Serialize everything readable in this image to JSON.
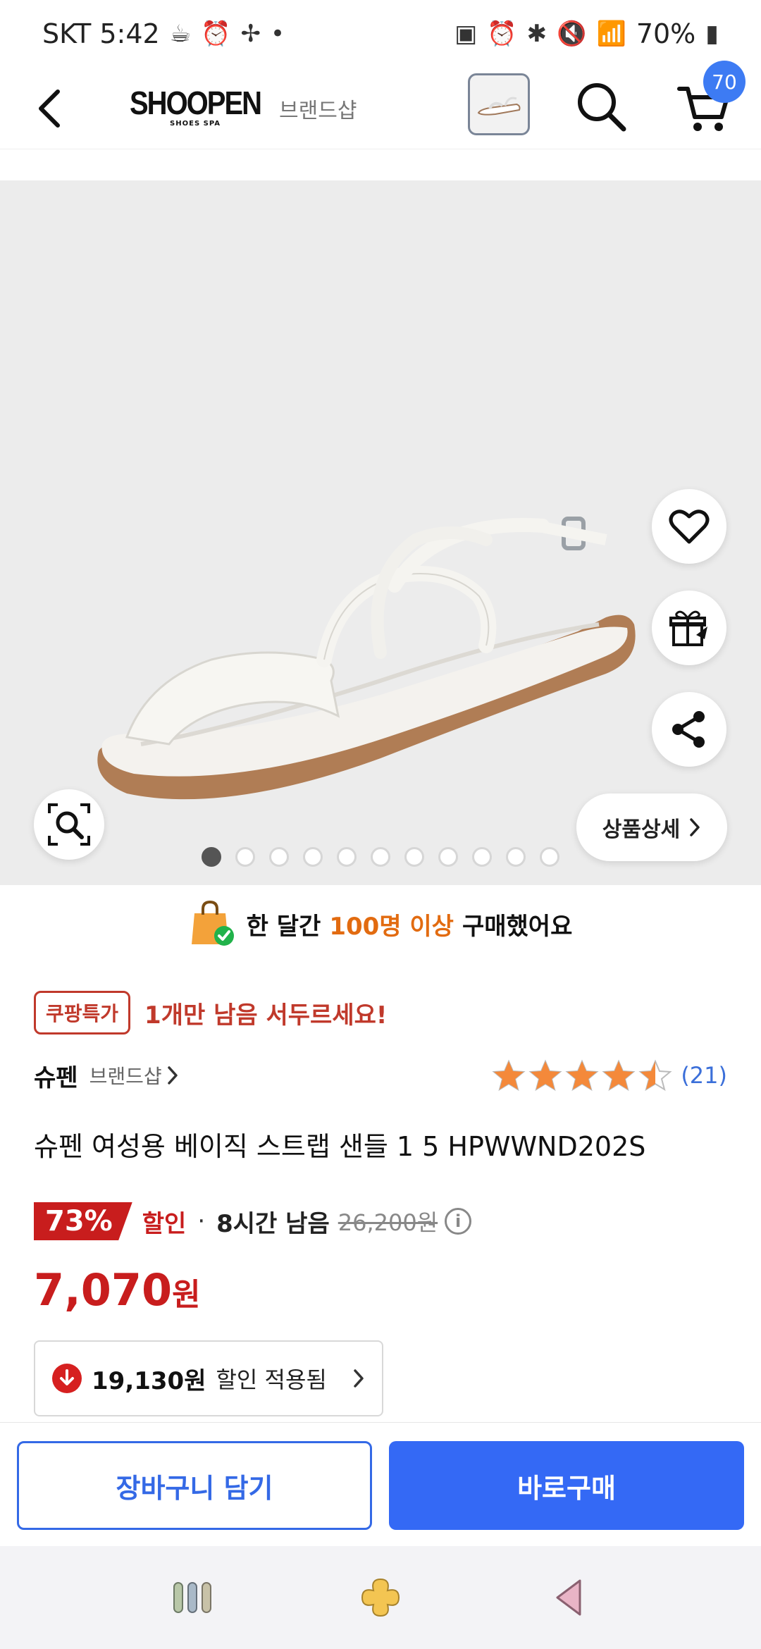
{
  "status_bar": {
    "carrier_time": "SKT 5:42",
    "battery": "70%"
  },
  "header": {
    "brand_logo_main": "SHOOPEN",
    "brand_logo_sub": "SHOES SPA",
    "brand_shop_label": "브랜드샵",
    "cart_count": "70"
  },
  "image": {
    "detail_button_label": "상품상세",
    "carousel": {
      "total": 11,
      "active_index": 0
    }
  },
  "purchase_banner": {
    "prefix": "한 달간",
    "highlight": "100명 이상",
    "suffix": "구매했어요"
  },
  "deal": {
    "badge": "쿠팡특가",
    "text": "1개만 남음 서두르세요!"
  },
  "brand": {
    "name": "슈펜",
    "shop_label": "브랜드샵"
  },
  "rating": {
    "stars": 4.5,
    "count": "(21)"
  },
  "product": {
    "title": "슈펜 여성용 베이직 스트랩 샌들 1 5 HPWWND202S"
  },
  "price": {
    "discount_percent": "73%",
    "discount_label": "할인",
    "separator": "·",
    "time_left": "8시간 남음",
    "original_price": "26,200원",
    "final_price_number": "7,070",
    "final_price_unit": "원"
  },
  "coupon": {
    "amount": "19,130원",
    "text": "할인 적용됨"
  },
  "actions": {
    "add_to_cart": "장바구니 담기",
    "buy_now": "바로구매"
  },
  "colors": {
    "accent_blue": "#3469f5",
    "sale_red": "#c81d1d",
    "highlight_orange": "#e26b10",
    "star_orange": "#f4893a"
  }
}
